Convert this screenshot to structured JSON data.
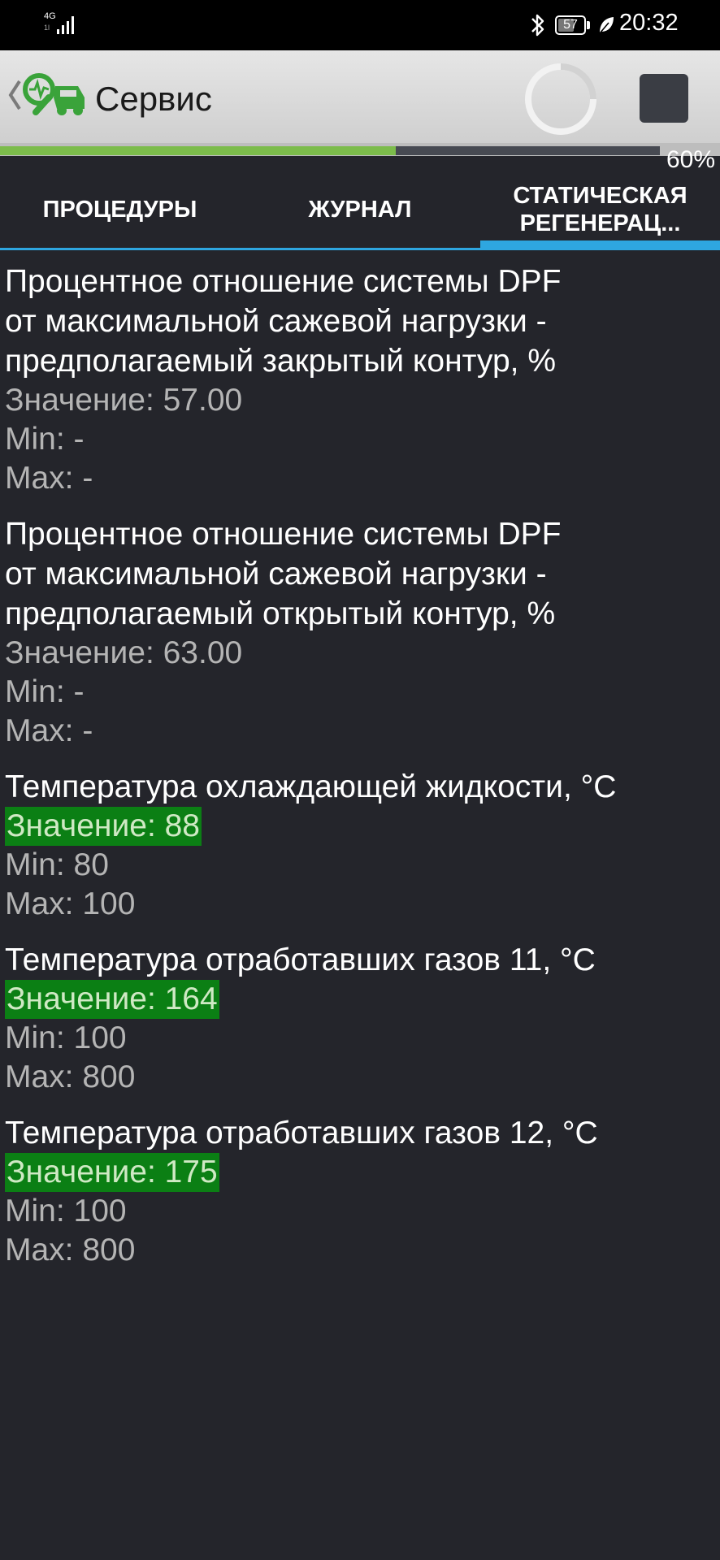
{
  "status_bar": {
    "network_label": "4G",
    "network_sub": "1l",
    "battery_level": "57",
    "time": "20:32"
  },
  "app_bar": {
    "title": "Сервис"
  },
  "progress": {
    "percent": 60,
    "label": "60%"
  },
  "tabs": [
    {
      "label": "ПРОЦЕДУРЫ",
      "selected": false
    },
    {
      "label": "ЖУРНАЛ",
      "selected": false
    },
    {
      "label": "СТАТИЧЕСКАЯ\nРЕГЕНЕРАЦ...",
      "selected": true
    }
  ],
  "colors": {
    "accent": "#2ea6e0",
    "progress_fill": "#7cbc4b",
    "value_ok_bg": "#0b7f14",
    "background": "#24252b"
  },
  "params": [
    {
      "name": "Процентное отношение системы DPF\nот максимальной сажевой нагрузки -\nпредполагаемый закрытый контур, %",
      "value": "Значение: 57.00",
      "min": "Min:  -",
      "max": "Max:  -",
      "highlight": false
    },
    {
      "name": "Процентное отношение системы DPF\nот максимальной сажевой нагрузки -\nпредполагаемый открытый контур, %",
      "value": "Значение: 63.00",
      "min": "Min:  -",
      "max": "Max:  -",
      "highlight": false
    },
    {
      "name": "Температура охлаждающей жидкости, °С",
      "value": "Значение: 88",
      "min": "Min: 80",
      "max": "Max: 100",
      "highlight": true
    },
    {
      "name": "Температура отработавших газов 11, °С",
      "value": "Значение: 164",
      "min": "Min: 100",
      "max": "Max: 800",
      "highlight": true
    },
    {
      "name": "Температура отработавших газов 12, °С",
      "value": "Значение: 175",
      "min": "Min: 100",
      "max": "Max: 800",
      "highlight": true
    }
  ]
}
